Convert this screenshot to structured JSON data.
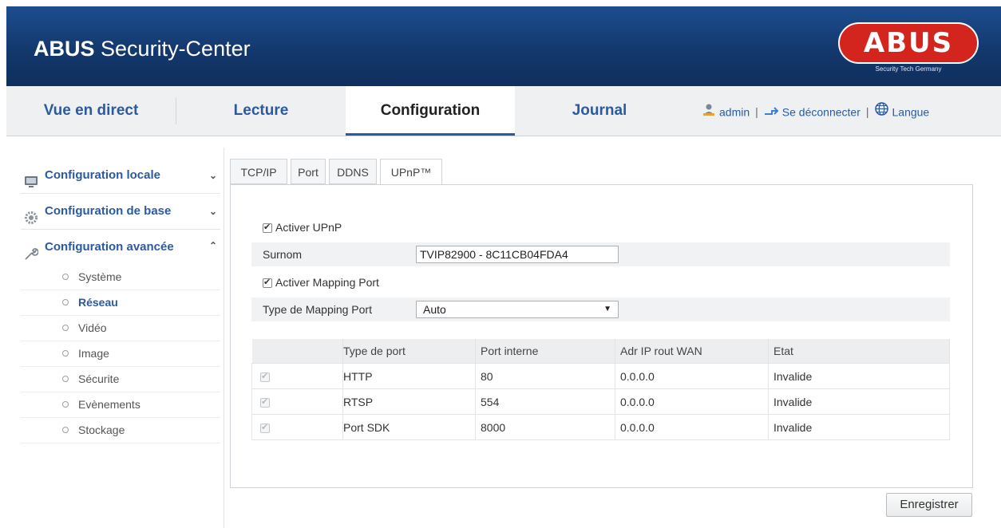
{
  "header": {
    "brand": "ABUS",
    "title": "Security-Center",
    "logo_text": "ABUS",
    "logo_tagline": "Security Tech Germany"
  },
  "nav": {
    "tabs": [
      {
        "label": "Vue en direct",
        "active": false
      },
      {
        "label": "Lecture",
        "active": false
      },
      {
        "label": "Configuration",
        "active": true
      },
      {
        "label": "Journal",
        "active": false
      }
    ],
    "user": "admin",
    "logout": "Se déconnecter",
    "language": "Langue"
  },
  "sidebar": {
    "sections": [
      {
        "label": "Configuration locale",
        "icon": "computer-icon",
        "expanded": false
      },
      {
        "label": "Configuration de base",
        "icon": "gear-icon",
        "expanded": false
      },
      {
        "label": "Configuration avancée",
        "icon": "wrench-icon",
        "expanded": true
      }
    ],
    "sub_items": [
      "Système",
      "Réseau",
      "Vidéo",
      "Image",
      "Sécurite",
      "Evènements",
      "Stockage"
    ],
    "active_sub": "Réseau"
  },
  "tabs": [
    "TCP/IP",
    "Port",
    "DDNS",
    "UPnP™"
  ],
  "active_tab": "UPnP™",
  "form": {
    "enable_upnp_label": "Activer UPnP",
    "enable_upnp": true,
    "nickname_label": "Surnom",
    "nickname_value": "TVIP82900 - 8C11CB04FDA4",
    "enable_mapping_label": "Activer Mapping Port",
    "enable_mapping": true,
    "mapping_type_label": "Type de Mapping Port",
    "mapping_type_value": "Auto"
  },
  "table": {
    "headers": [
      "",
      "Type de port",
      "Port interne",
      "Adr IP rout WAN",
      "Etat"
    ],
    "rows": [
      {
        "checked": true,
        "type": "HTTP",
        "port": "80",
        "wan_ip": "0.0.0.0",
        "state": "Invalide"
      },
      {
        "checked": true,
        "type": "RTSP",
        "port": "554",
        "wan_ip": "0.0.0.0",
        "state": "Invalide"
      },
      {
        "checked": true,
        "type": "Port SDK",
        "port": "8000",
        "wan_ip": "0.0.0.0",
        "state": "Invalide"
      }
    ]
  },
  "save_label": "Enregistrer",
  "colors": {
    "header_bg": "#13386d",
    "accent": "#2b5aa0",
    "logo_red": "#d3251e"
  }
}
